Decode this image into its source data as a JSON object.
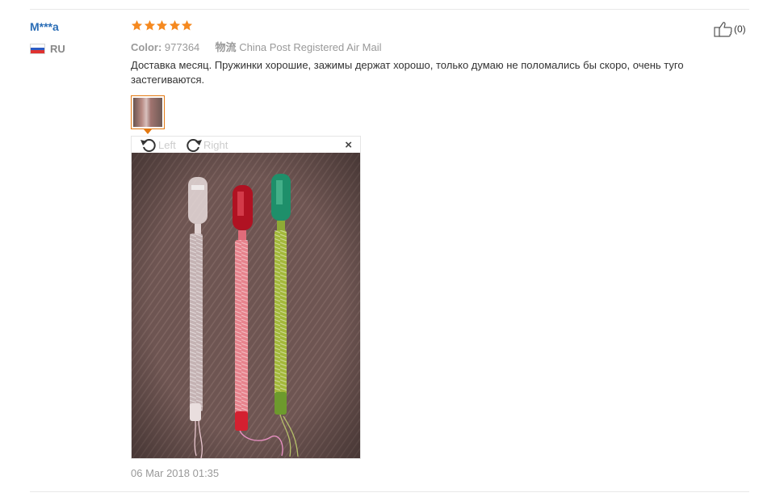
{
  "review": {
    "user": {
      "name": "M***a",
      "country_code": "RU"
    },
    "rating": 5,
    "meta": {
      "color_key": "Color:",
      "color_value": "977364",
      "shipping_key": "物流",
      "shipping_value": "China Post Registered Air Mail"
    },
    "text": "Доставка месяц. Пружинки хорошие, зажимы держат хорошо, только думаю не поломались бы скоро, очень туго застегиваются.",
    "helpful": {
      "count": "(0)"
    },
    "viewer": {
      "rotate_left_label": "Left",
      "rotate_right_label": "Right",
      "close_label": "×"
    },
    "date": "06 Mar 2018 01:35"
  },
  "colors": {
    "username": "#2a6db6",
    "star": "#f5891f",
    "accent": "#e47911",
    "muted": "#999999",
    "flag": [
      "#ffffff",
      "#2b5bc4",
      "#e0322f"
    ]
  },
  "icons": [
    "star-icon",
    "russia-flag-icon",
    "thumbs-up-icon",
    "rotate-left-icon",
    "rotate-right-icon",
    "close-icon"
  ]
}
